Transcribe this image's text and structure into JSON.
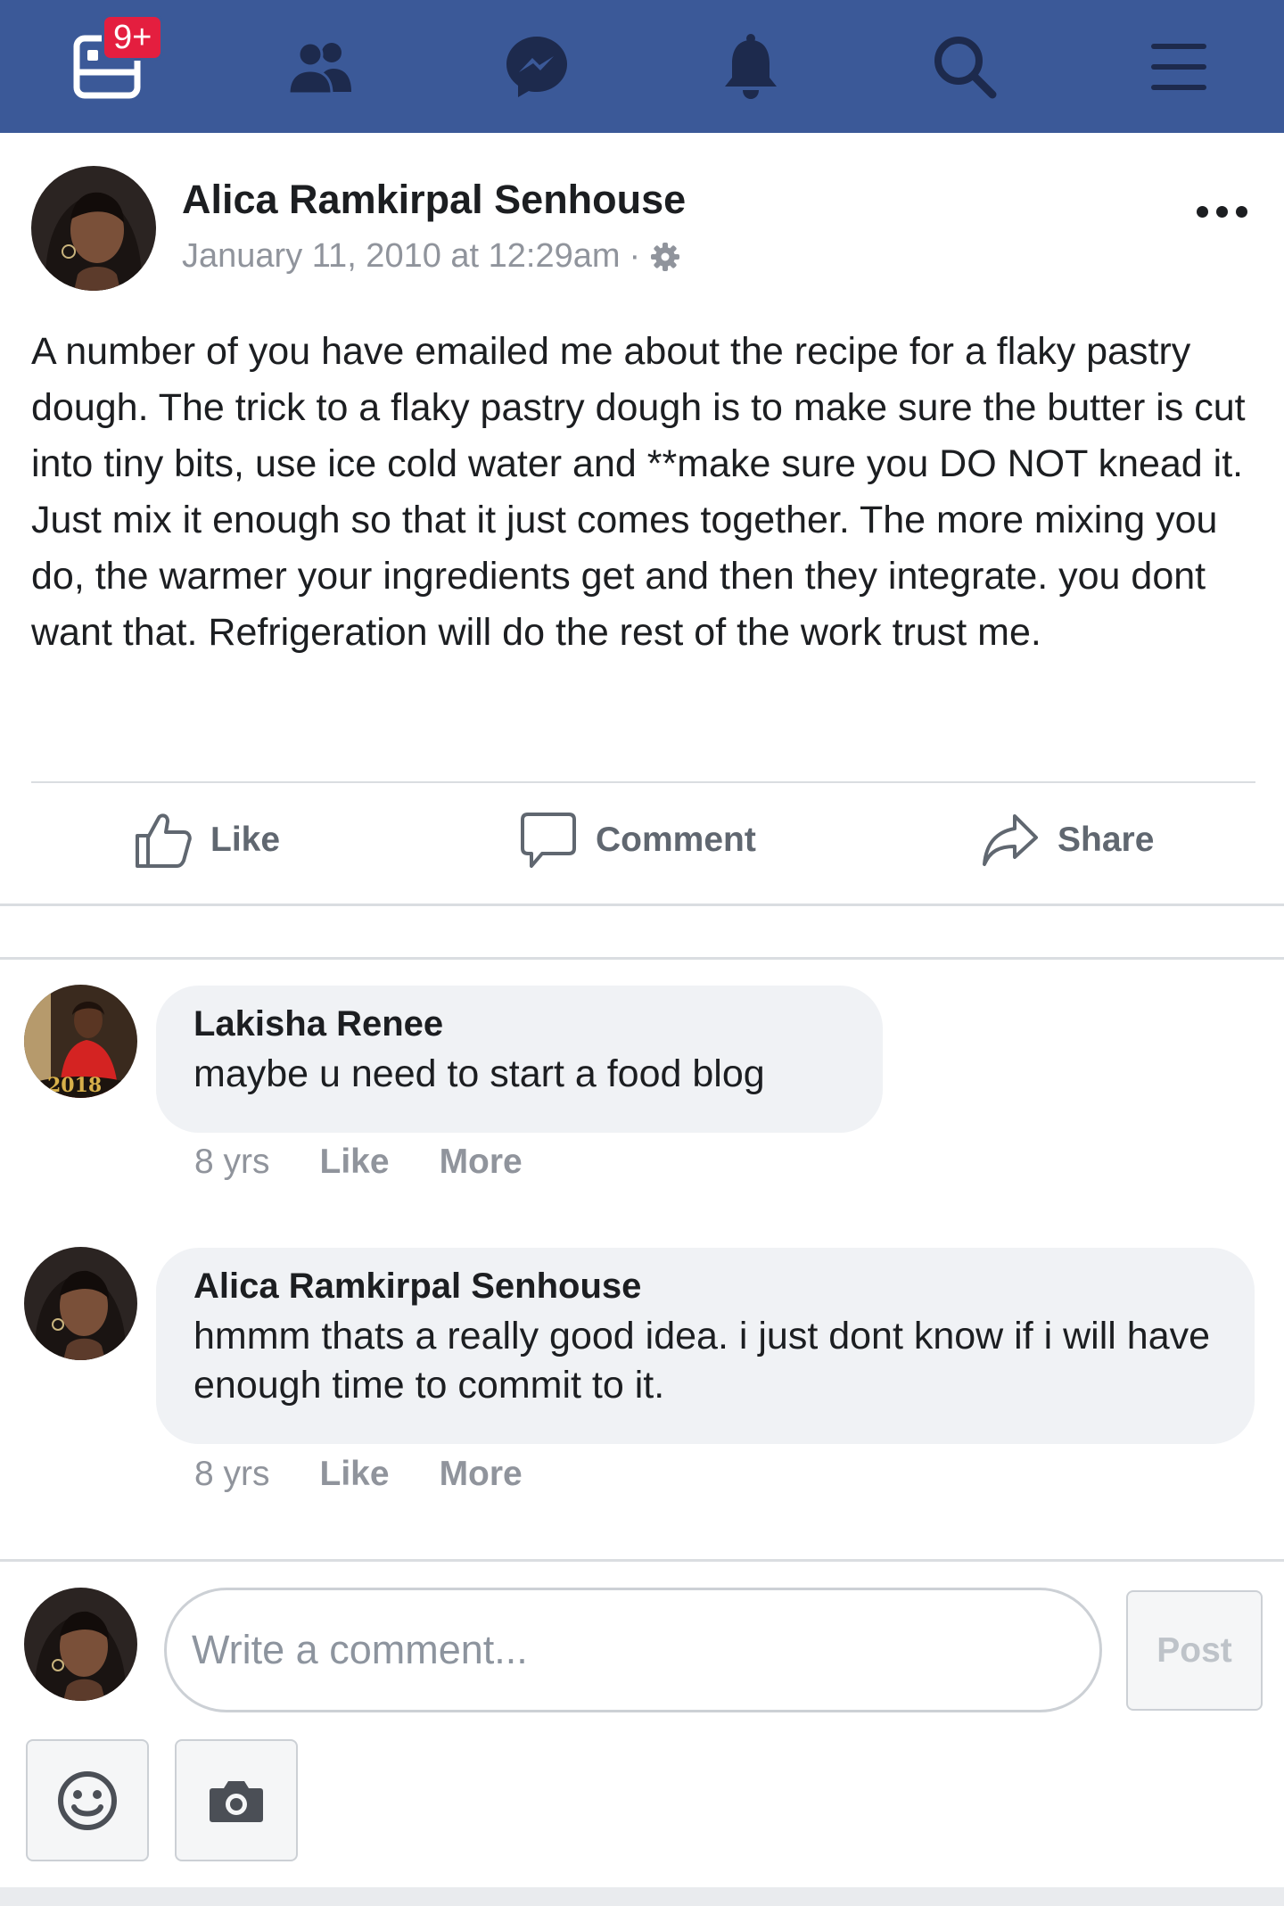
{
  "nav": {
    "badge": "9+",
    "icons": [
      "feed-icon",
      "friends-icon",
      "messenger-icon",
      "notifications-icon",
      "search-icon",
      "menu-icon"
    ]
  },
  "post": {
    "author": "Alica Ramkirpal Senhouse",
    "timestamp": "January 11, 2010 at 12:29am",
    "separator": "·",
    "privacy_icon": "gear-icon",
    "body": "A number of you have emailed me about the recipe for a flaky pastry dough. The trick to a flaky pastry dough is to make sure the butter is cut into tiny bits, use ice cold water and **make sure you DO NOT knead it. Just mix it enough so that it just comes together. The more mixing you do, the warmer your ingredients get and then they integrate. you dont want that. Refrigeration will do the rest of the work trust me."
  },
  "actions": {
    "like": "Like",
    "comment": "Comment",
    "share": "Share"
  },
  "comments": [
    {
      "name": "Lakisha Renee",
      "text": "maybe u need to start a food blog",
      "time": "8 yrs",
      "like": "Like",
      "more": "More"
    },
    {
      "name": "Alica Ramkirpal Senhouse",
      "text": "hmmm thats a really good idea. i just dont know if i will have enough time to commit to it.",
      "time": "8 yrs",
      "like": "Like",
      "more": "More"
    }
  ],
  "composer": {
    "placeholder": "Write a comment...",
    "post_label": "Post",
    "tools": [
      "smiley-icon",
      "camera-icon"
    ]
  },
  "colors": {
    "brand": "#3b5998",
    "badge": "#e41e3f",
    "bubble": "#f0f2f5",
    "muted": "#90949c"
  }
}
